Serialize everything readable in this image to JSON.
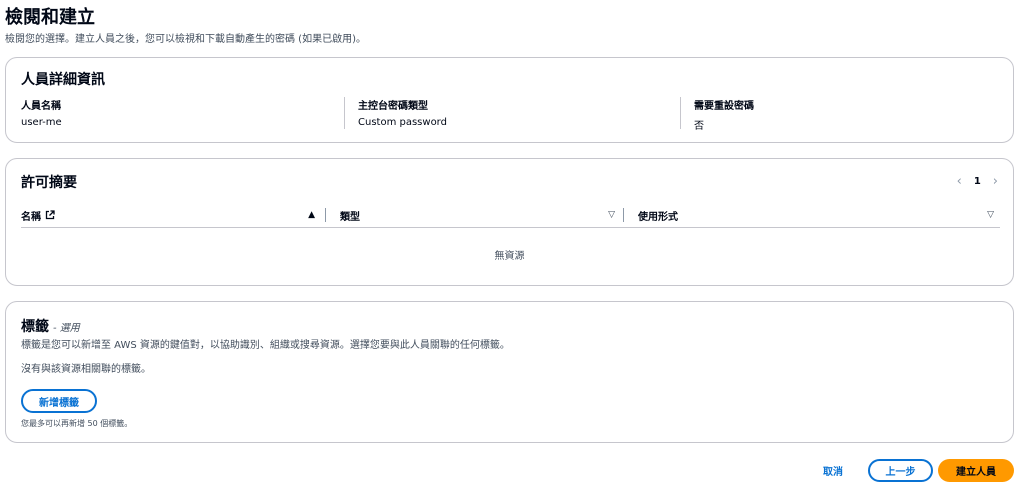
{
  "header": {
    "title": "檢閱和建立",
    "description": "檢閱您的選擇。建立人員之後，您可以檢視和下載自動產生的密碼 (如果已啟用)。"
  },
  "details": {
    "title": "人員詳細資訊",
    "fields": [
      {
        "label": "人員名稱",
        "value": "user-me"
      },
      {
        "label": "主控台密碼類型",
        "value": "Custom password"
      },
      {
        "label": "需要重設密碼",
        "value": "否"
      }
    ]
  },
  "permissions": {
    "title": "許可摘要",
    "pager": {
      "prev_icon": "chevron-left-icon",
      "page": "1",
      "next_icon": "chevron-right-icon"
    },
    "columns": [
      {
        "label": "名稱",
        "sort": "ascending"
      },
      {
        "label": "類型",
        "sort": "none"
      },
      {
        "label": "使用形式",
        "sort": "none"
      }
    ],
    "empty_message": "無資源"
  },
  "tags": {
    "title": "標籤",
    "optional_label": "- 選用",
    "description": "標籤是您可以新增至 AWS 資源的鍵值對，以協助識別、組織或搜尋資源。選擇您要與此人員關聯的任何標籤。",
    "none_message": "沒有與該資源相關聯的標籤。",
    "add_button": "新增標籤",
    "limit_text": "您最多可以再新增 50 個標籤。"
  },
  "footer": {
    "cancel": "取消",
    "previous": "上一步",
    "create": "建立人員"
  },
  "colors": {
    "primary": "#0972d3",
    "accent": "#ff9900",
    "border": "#c6c6cd"
  }
}
